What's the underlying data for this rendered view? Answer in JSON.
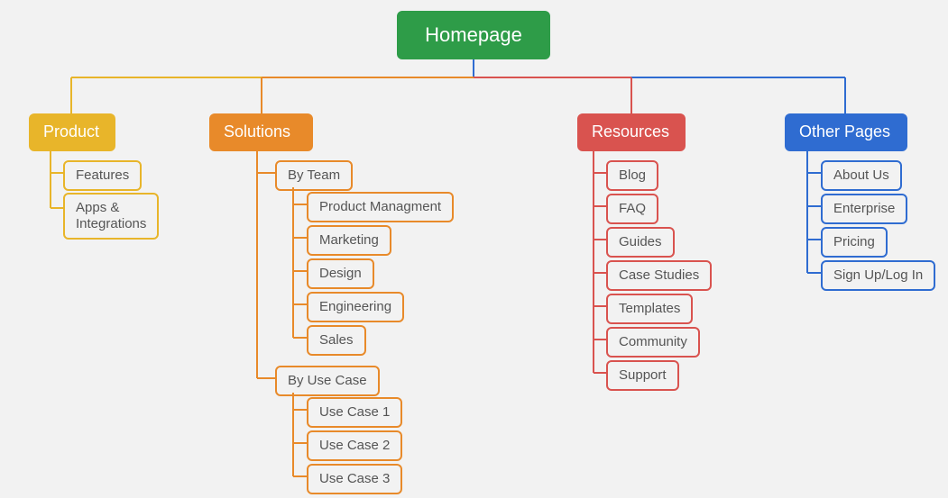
{
  "root": {
    "label": "Homepage"
  },
  "product": {
    "label": "Product",
    "children": [
      {
        "label": "Features"
      },
      {
        "label": "Apps & Integrations"
      }
    ]
  },
  "solutions": {
    "label": "Solutions",
    "groups": [
      {
        "label": "By Team",
        "children": [
          {
            "label": "Product Managment"
          },
          {
            "label": "Marketing"
          },
          {
            "label": "Design"
          },
          {
            "label": "Engineering"
          },
          {
            "label": "Sales"
          }
        ]
      },
      {
        "label": "By Use Case",
        "children": [
          {
            "label": "Use Case 1"
          },
          {
            "label": "Use Case 2"
          },
          {
            "label": "Use Case 3"
          }
        ]
      }
    ]
  },
  "resources": {
    "label": "Resources",
    "children": [
      {
        "label": "Blog"
      },
      {
        "label": "FAQ"
      },
      {
        "label": "Guides"
      },
      {
        "label": "Case Studies"
      },
      {
        "label": "Templates"
      },
      {
        "label": "Community"
      },
      {
        "label": "Support"
      }
    ]
  },
  "other": {
    "label": "Other Pages",
    "children": [
      {
        "label": "About Us"
      },
      {
        "label": "Enterprise"
      },
      {
        "label": "Pricing"
      },
      {
        "label": "Sign Up/Log In"
      }
    ]
  },
  "colors": {
    "green": "#2e9c48",
    "yellow": "#e8b52a",
    "orange": "#e88a2a",
    "red": "#d9534f",
    "blue": "#2f6cd1"
  }
}
